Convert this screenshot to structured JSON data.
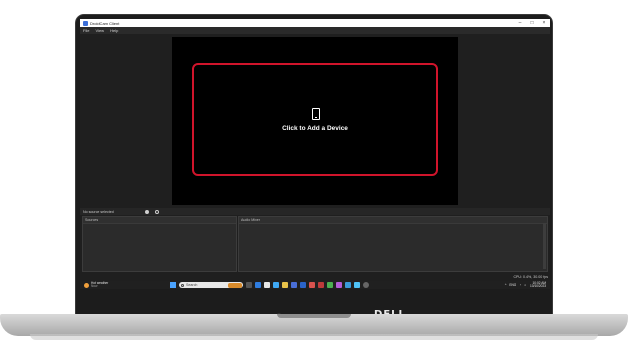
{
  "window": {
    "title": "DroidCam Client",
    "controls": [
      "–",
      "□",
      "×"
    ]
  },
  "menu": [
    "File",
    "View",
    "Help"
  ],
  "preview": {
    "prompt": "Click to Add a Device",
    "icon": "phone-icon",
    "accent": "#d0142b"
  },
  "status": {
    "no_source": "No source selected",
    "options": [
      "",
      ""
    ]
  },
  "panels": {
    "sources_title": "Sources",
    "audio_title": "Audio Mixer"
  },
  "stats": "CPU: 0.4%, 30.00 fps",
  "taskbar": {
    "weather_title": "Hot weather",
    "weather_sub": "Now",
    "search_placeholder": "Search",
    "tray_lang": "ENG",
    "time": "10:02 AM",
    "date": "10/10/2023"
  },
  "brand": "DELL"
}
